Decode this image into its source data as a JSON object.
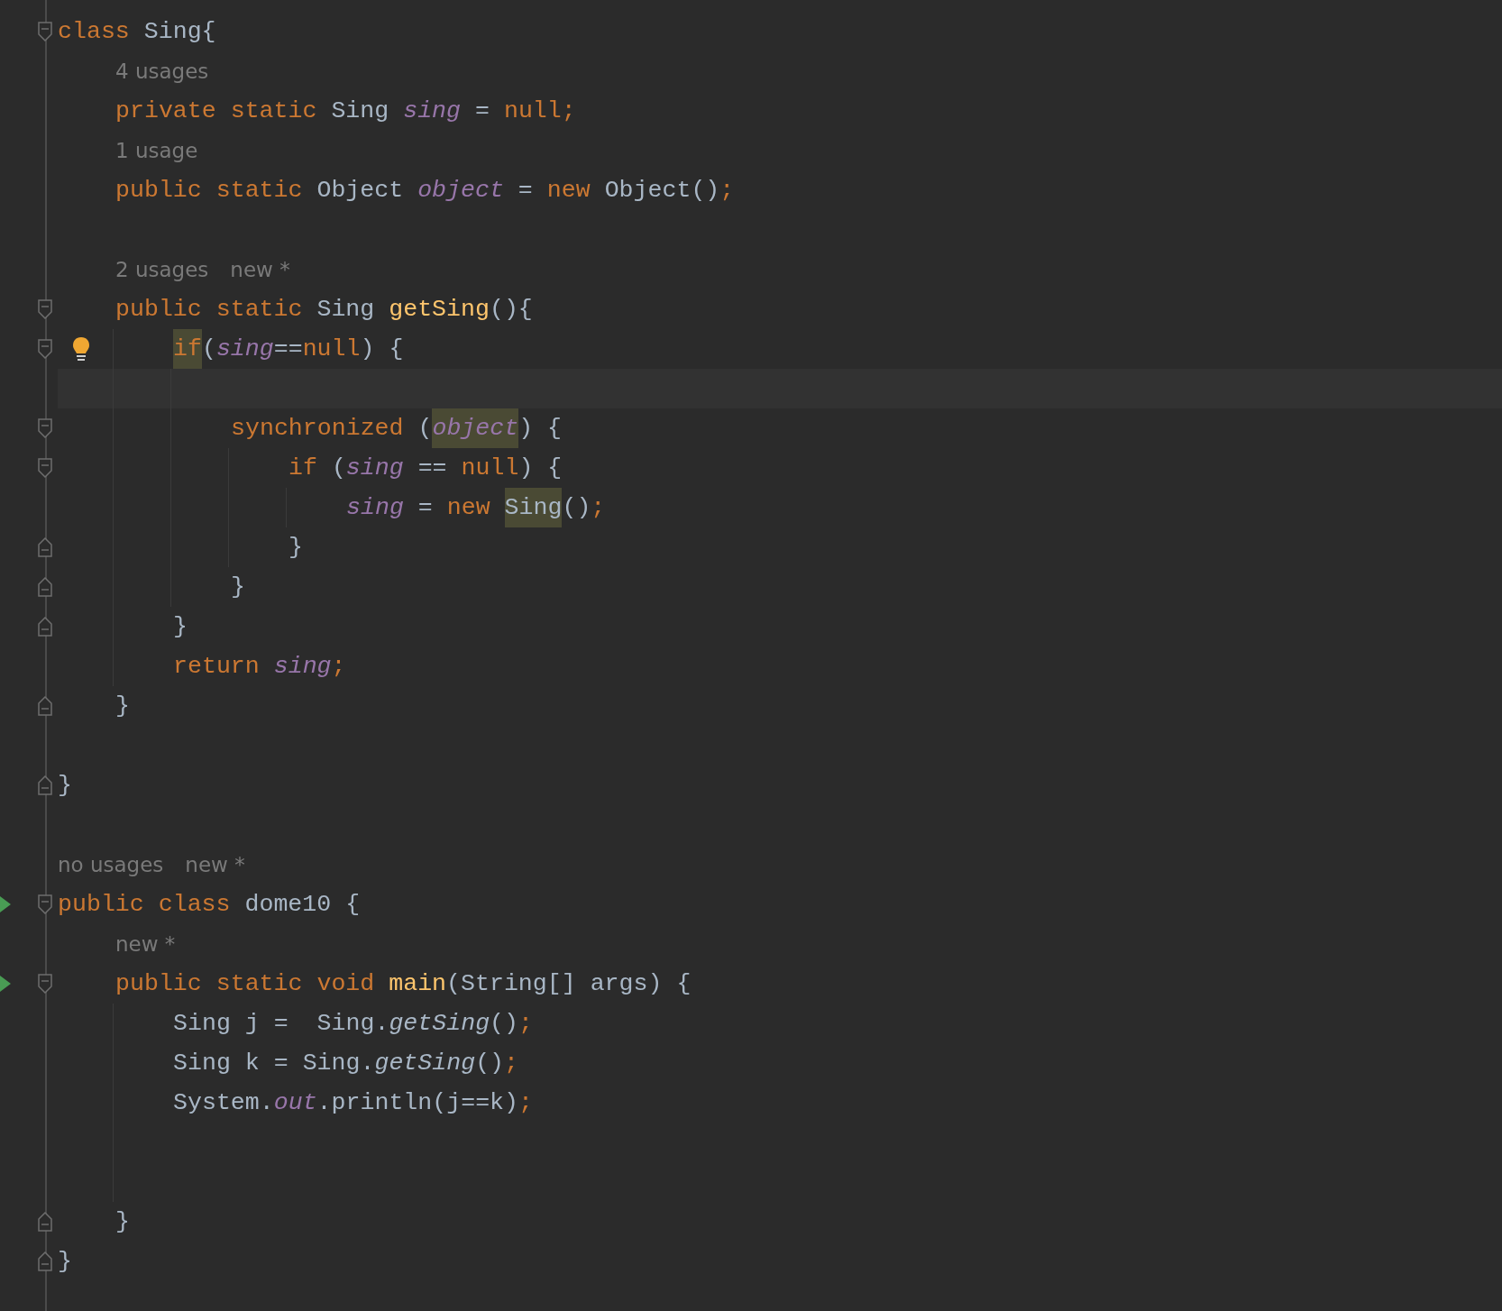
{
  "lines": [
    {
      "kind": "code",
      "fold": {
        "kind": "open"
      },
      "tokens": [
        {
          "t": "class",
          "kind": "kw"
        },
        {
          "t": " Sing{",
          "kind": "p"
        }
      ],
      "children": [
        {
          "kind": "hint",
          "hints": [
            "4 usages"
          ]
        },
        {
          "kind": "code",
          "tokens": [
            {
              "t": "private static",
              "kind": "kw"
            },
            {
              "t": " Sing ",
              "kind": "p"
            },
            {
              "t": "sing",
              "kind": "f"
            },
            {
              "t": " = ",
              "kind": "p"
            },
            {
              "t": "null;",
              "kind": "kw"
            }
          ]
        },
        {
          "kind": "hint",
          "hints": [
            "1 usage"
          ]
        },
        {
          "kind": "code",
          "tokens": [
            {
              "t": "public static",
              "kind": "kw"
            },
            {
              "t": " Object ",
              "kind": "p"
            },
            {
              "t": "object",
              "kind": "f"
            },
            {
              "t": " = ",
              "kind": "p"
            },
            {
              "t": "new",
              "kind": "kw"
            },
            {
              "t": " Object()",
              "kind": "p"
            },
            {
              "t": ";",
              "kind": "kw"
            }
          ]
        },
        {
          "kind": "blank"
        },
        {
          "kind": "hint",
          "hints": [
            "2 usages",
            "new *"
          ]
        },
        {
          "kind": "code",
          "fold": {
            "kind": "open"
          },
          "tokens": [
            {
              "t": "public static",
              "kind": "kw"
            },
            {
              "t": " Sing ",
              "kind": "p"
            },
            {
              "t": "getSing",
              "kind": "m"
            },
            {
              "t": "(){",
              "kind": "p"
            }
          ],
          "children": [
            {
              "kind": "code",
              "fold": {
                "kind": "open"
              },
              "bulb": true,
              "tokens": [
                {
                  "t": "if",
                  "kind": "kw",
                  "highlight": true
                },
                {
                  "t": "(",
                  "kind": "p"
                },
                {
                  "t": "sing",
                  "kind": "f"
                },
                {
                  "t": "==",
                  "kind": "p"
                },
                {
                  "t": "null",
                  "kind": "kw"
                },
                {
                  "t": ") {",
                  "kind": "p"
                }
              ],
              "children": [
                {
                  "kind": "blank",
                  "current": true
                },
                {
                  "kind": "code",
                  "fold": {
                    "kind": "open"
                  },
                  "tokens": [
                    {
                      "t": "synchronized",
                      "kind": "kw"
                    },
                    {
                      "t": " (",
                      "kind": "p"
                    },
                    {
                      "t": "object",
                      "kind": "f",
                      "highlight": true
                    },
                    {
                      "t": ") {",
                      "kind": "p"
                    }
                  ],
                  "children": [
                    {
                      "kind": "code",
                      "fold": {
                        "kind": "open"
                      },
                      "tokens": [
                        {
                          "t": "if",
                          "kind": "kw"
                        },
                        {
                          "t": " (",
                          "kind": "p"
                        },
                        {
                          "t": "sing",
                          "kind": "f"
                        },
                        {
                          "t": " == ",
                          "kind": "p"
                        },
                        {
                          "t": "null",
                          "kind": "kw"
                        },
                        {
                          "t": ") {",
                          "kind": "p"
                        }
                      ],
                      "children": [
                        {
                          "kind": "code",
                          "tokens": [
                            {
                              "t": "sing",
                              "kind": "f"
                            },
                            {
                              "t": " = ",
                              "kind": "p"
                            },
                            {
                              "t": "new ",
                              "kind": "kw"
                            },
                            {
                              "t": "Sing",
                              "kind": "p",
                              "highlight": true
                            },
                            {
                              "t": "()",
                              "kind": "p"
                            },
                            {
                              "t": ";",
                              "kind": "kw"
                            }
                          ]
                        }
                      ]
                    },
                    {
                      "kind": "code",
                      "fold": {
                        "kind": "close"
                      },
                      "tokens": [
                        {
                          "t": "}",
                          "kind": "p"
                        }
                      ]
                    }
                  ]
                },
                {
                  "kind": "code",
                  "fold": {
                    "kind": "close"
                  },
                  "tokens": [
                    {
                      "t": "}",
                      "kind": "p"
                    }
                  ]
                }
              ]
            },
            {
              "kind": "code",
              "fold": {
                "kind": "close"
              },
              "tokens": [
                {
                  "t": "}",
                  "kind": "p"
                }
              ]
            },
            {
              "kind": "code",
              "tokens": [
                {
                  "t": "return ",
                  "kind": "kw"
                },
                {
                  "t": "sing",
                  "kind": "f"
                },
                {
                  "t": ";",
                  "kind": "kw"
                }
              ]
            }
          ]
        },
        {
          "kind": "code",
          "fold": {
            "kind": "close"
          },
          "tokens": [
            {
              "t": "}",
              "kind": "p"
            }
          ]
        },
        {
          "kind": "blank"
        }
      ]
    },
    {
      "kind": "code",
      "fold": {
        "kind": "close"
      },
      "tokens": [
        {
          "t": "}",
          "kind": "p"
        }
      ]
    },
    {
      "kind": "blank"
    },
    {
      "kind": "hint",
      "hints": [
        "no usages",
        "new *"
      ]
    },
    {
      "kind": "code",
      "fold": {
        "kind": "open"
      },
      "run": true,
      "tokens": [
        {
          "t": "public class",
          "kind": "kw"
        },
        {
          "t": " dome10 {",
          "kind": "p"
        }
      ],
      "children": [
        {
          "kind": "hint",
          "hints": [
            "new *"
          ]
        },
        {
          "kind": "code",
          "fold": {
            "kind": "open"
          },
          "run": true,
          "tokens": [
            {
              "t": "public static void ",
              "kind": "kw"
            },
            {
              "t": "main",
              "kind": "m"
            },
            {
              "t": "(String[] args) {",
              "kind": "p"
            }
          ],
          "children": [
            {
              "kind": "code",
              "tokens": [
                {
                  "t": "Sing j =  Sing.",
                  "kind": "p"
                },
                {
                  "t": "getSing",
                  "kind": "s"
                },
                {
                  "t": "()",
                  "kind": "p"
                },
                {
                  "t": ";",
                  "kind": "kw"
                }
              ]
            },
            {
              "kind": "code",
              "tokens": [
                {
                  "t": "Sing k = Sing.",
                  "kind": "p"
                },
                {
                  "t": "getSing",
                  "kind": "s"
                },
                {
                  "t": "()",
                  "kind": "p"
                },
                {
                  "t": ";",
                  "kind": "kw"
                }
              ]
            },
            {
              "kind": "code",
              "tokens": [
                {
                  "t": "System.",
                  "kind": "p"
                },
                {
                  "t": "out",
                  "kind": "f"
                },
                {
                  "t": ".println(j==k)",
                  "kind": "p"
                },
                {
                  "t": ";",
                  "kind": "kw"
                }
              ]
            },
            {
              "kind": "blank"
            },
            {
              "kind": "blank"
            }
          ]
        },
        {
          "kind": "code",
          "fold": {
            "kind": "close"
          },
          "tokens": [
            {
              "t": "}",
              "kind": "p"
            }
          ]
        }
      ]
    },
    {
      "kind": "code",
      "fold": {
        "kind": "close"
      },
      "tokens": [
        {
          "t": "}",
          "kind": "p"
        }
      ]
    }
  ]
}
